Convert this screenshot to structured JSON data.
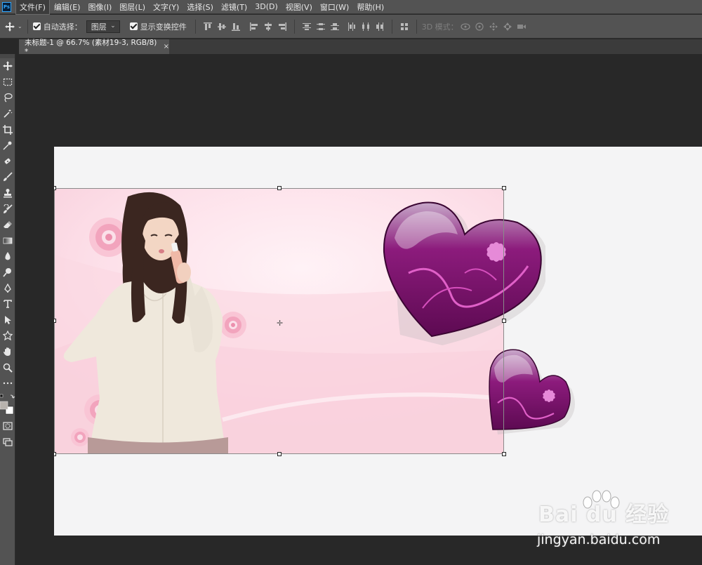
{
  "menubar": {
    "app_icon": "ps-logo-icon",
    "items": [
      {
        "label": "文件(F)"
      },
      {
        "label": "编辑(E)"
      },
      {
        "label": "图像(I)"
      },
      {
        "label": "图层(L)"
      },
      {
        "label": "文字(Y)"
      },
      {
        "label": "选择(S)"
      },
      {
        "label": "滤镜(T)"
      },
      {
        "label": "3D(D)"
      },
      {
        "label": "视图(V)"
      },
      {
        "label": "窗口(W)"
      },
      {
        "label": "帮助(H)"
      }
    ]
  },
  "options": {
    "auto_select_label": "自动选择：",
    "auto_select_checked": true,
    "target_value": "图层",
    "show_transform_label": "显示变换控件",
    "show_transform_checked": true,
    "mode_3d_label": "3D 模式："
  },
  "document": {
    "tab_title": "未标题-1 @ 66.7% (素材19-3, RGB/8) *",
    "close_label": "×"
  },
  "tools": [
    "move-tool-icon",
    "marquee-tool-icon",
    "lasso-tool-icon",
    "magic-wand-tool-icon",
    "crop-tool-icon",
    "eyedropper-tool-icon",
    "healing-brush-tool-icon",
    "brush-tool-icon",
    "clone-stamp-tool-icon",
    "history-brush-tool-icon",
    "eraser-tool-icon",
    "gradient-tool-icon",
    "blur-tool-icon",
    "dodge-tool-icon",
    "pen-tool-icon",
    "type-tool-icon",
    "path-selection-tool-icon",
    "custom-shape-tool-icon",
    "hand-tool-icon",
    "zoom-tool-icon",
    "more-tools-icon",
    "color-swatches-icon",
    "quick-mask-icon",
    "screen-mode-icon"
  ],
  "colors": {
    "panel_bg": "#535353",
    "workspace_bg": "#282828",
    "canvas_bg": "#f4f4f5",
    "heart_purple": "#7a0f6a",
    "accent_pink": "#e88fb0"
  },
  "watermark": {
    "logo_text": "Bai du 经验",
    "url": "jingyan.baidu.com"
  }
}
